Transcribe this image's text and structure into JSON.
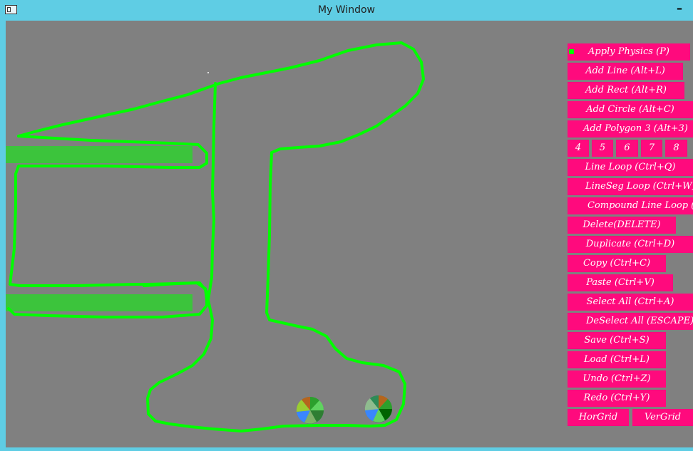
{
  "window": {
    "title": "My Window",
    "minimize_label": "–"
  },
  "buttons": {
    "apply_physics": "Apply Physics (P)",
    "add_line": "Add Line (Alt+L)",
    "add_rect": "Add Rect (Alt+R)",
    "add_circle": "Add Circle (Alt+C)",
    "add_polygon": "Add Polygon 3 (Alt+3)",
    "sides": [
      "4",
      "5",
      "6",
      "7",
      "8"
    ],
    "line_loop": "Line Loop (Ctrl+Q)",
    "lineseg_loop": "LineSeg Loop (Ctrl+W)",
    "compound_line_loop": "Compound Line Loop (",
    "delete": "Delete(DELETE)",
    "duplicate": "Duplicate (Ctrl+D)",
    "copy": "Copy (Ctrl+C)",
    "paste": "Paste (Ctrl+V)",
    "select_all": "Select All (Ctrl+A)",
    "deselect_all": "DeSelect All (ESCAPE)",
    "save": "Save (Ctrl+S)",
    "load": "Load (Ctrl+L)",
    "undo": "Undo (Ctrl+Z)",
    "redo": "Redo (Ctrl+Y)",
    "hor_grid": "HorGrid",
    "ver_grid": "VerGrid"
  },
  "colors": {
    "titlebar": "#5fcde4",
    "canvas": "#808080",
    "button": "#ff0a7d",
    "line": "#00ff00",
    "rect_fill": "#3cc43c"
  }
}
